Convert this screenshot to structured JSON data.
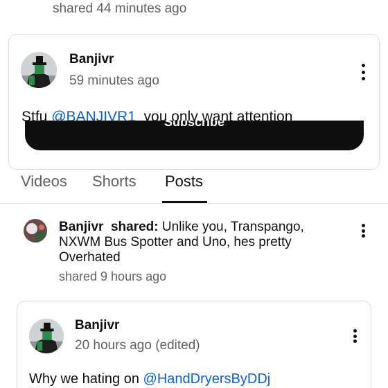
{
  "prev_post": {
    "time": "shared 44 minutes ago"
  },
  "comment_card": {
    "author": "Banjivr",
    "time": "59 minutes ago",
    "text_before": "Stfu ",
    "mention": "@BANJIVR1",
    "text_after": "  you only want attention",
    "menu_icon": "more-vert-icon"
  },
  "subscribe": {
    "label": "Subscribe"
  },
  "tabs": [
    {
      "label": "Videos",
      "active": false
    },
    {
      "label": "Shorts",
      "active": false
    },
    {
      "label": "Posts",
      "active": true
    }
  ],
  "shared_post": {
    "author": "Banjivr",
    "shared_word": "shared:",
    "text_line1": "Unlike you, Transpango,",
    "text_line2": "NXWM Bus Spotter and Uno, hes pretty",
    "text_line3": "Overhated",
    "time": "shared 9 hours ago"
  },
  "inner_post": {
    "author": "Banjivr",
    "time": "20 hours ago (edited)",
    "text_before": "Why we hating on ",
    "mention": "@HandDryersByDDj"
  }
}
